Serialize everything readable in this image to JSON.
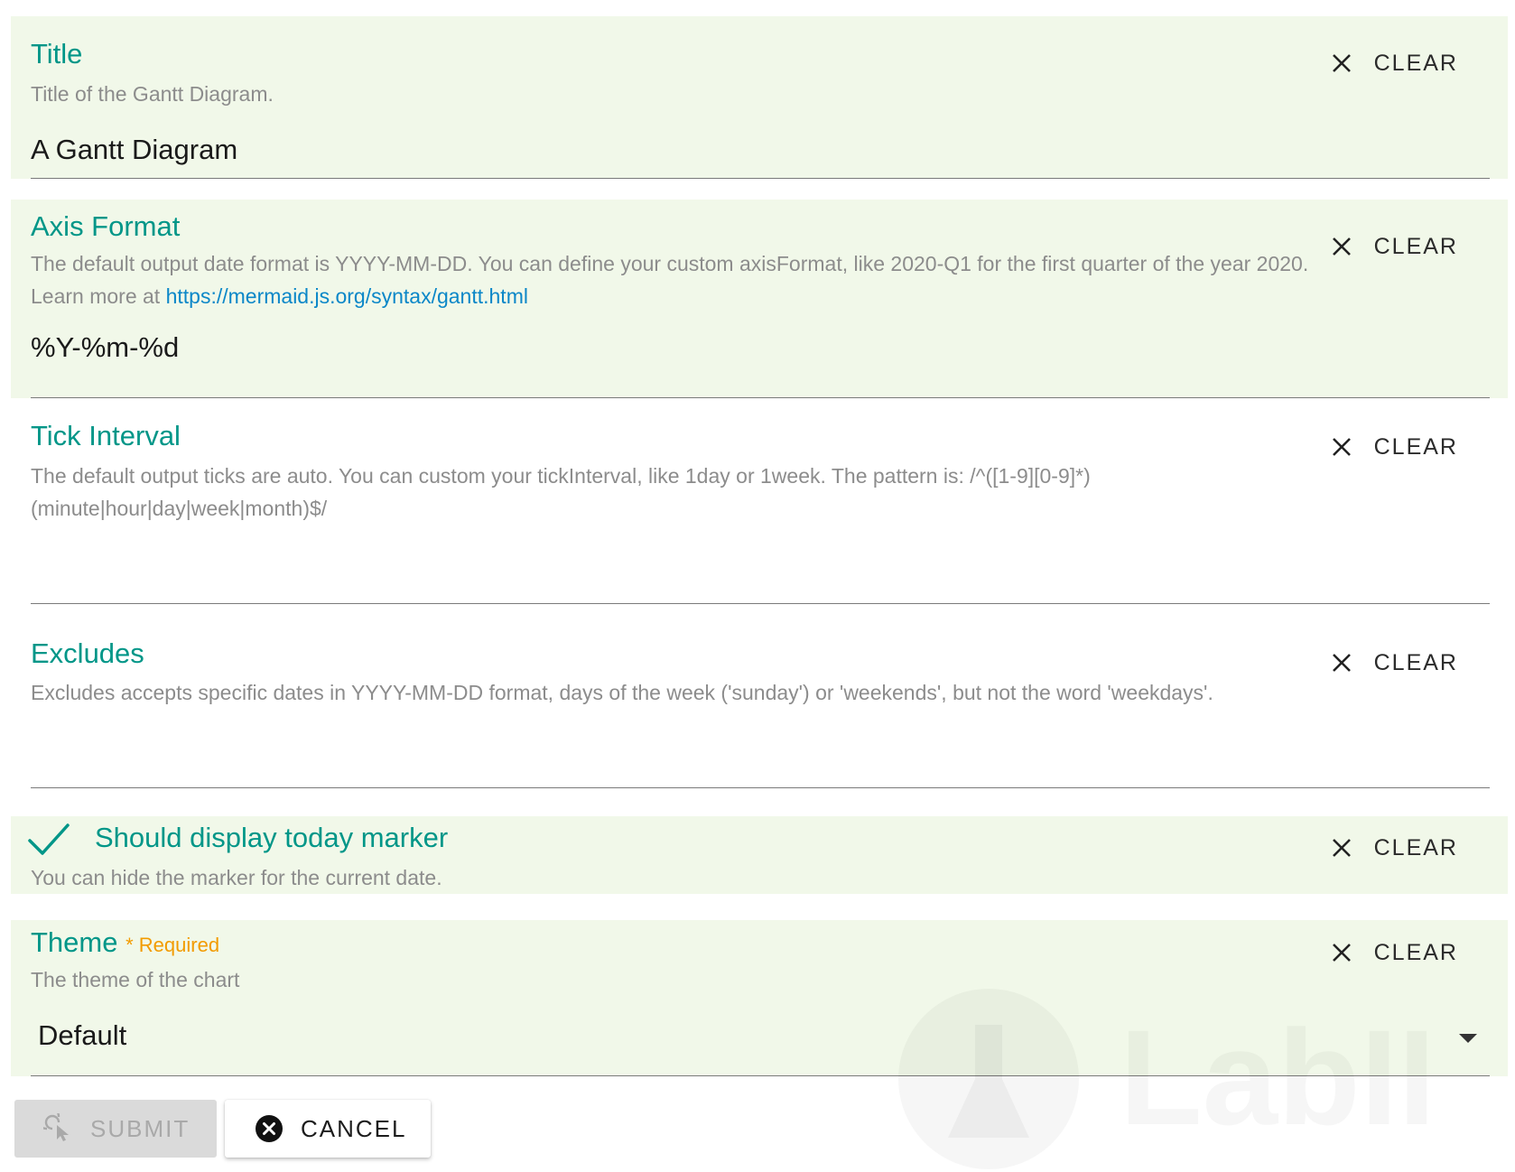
{
  "fields": {
    "title": {
      "label": "Title",
      "hint": "Title of the Gantt Diagram.",
      "value": "A Gantt Diagram",
      "clear": "CLEAR"
    },
    "axis_format": {
      "label": "Axis Format",
      "hint": "The default output date format is YYYY-MM-DD. You can define your custom axisFormat, like 2020-Q1 for the first quarter of the year 2020. Learn more at ",
      "link": "https://mermaid.js.org/syntax/gantt.html",
      "value": "%Y-%m-%d",
      "clear": "CLEAR"
    },
    "tick_interval": {
      "label": "Tick Interval",
      "hint": "The default output ticks are auto. You can custom your tickInterval, like 1day or 1week. The pattern is: /^([1-9][0-9]*)(minute|hour|day|week|month)$/",
      "value": "",
      "clear": "CLEAR"
    },
    "excludes": {
      "label": "Excludes",
      "hint": "Excludes accepts specific dates in YYYY-MM-DD format, days of the week ('sunday') or 'weekends', but not the word 'weekdays'.",
      "value": "",
      "clear": "CLEAR"
    },
    "today_marker": {
      "label": "Should display today marker",
      "hint": "You can hide the marker for the current date.",
      "checked": true,
      "clear": "CLEAR"
    },
    "theme": {
      "label": "Theme",
      "required": "* Required",
      "hint": "The theme of the chart",
      "value": "Default",
      "clear": "CLEAR"
    }
  },
  "buttons": {
    "submit": "SUBMIT",
    "cancel": "CANCEL"
  },
  "watermark": {
    "text": "LabII"
  },
  "colors": {
    "accent": "#009688",
    "filled_bg": "#f1f8e9",
    "required": "#f29b00",
    "link": "#0b87c8"
  }
}
